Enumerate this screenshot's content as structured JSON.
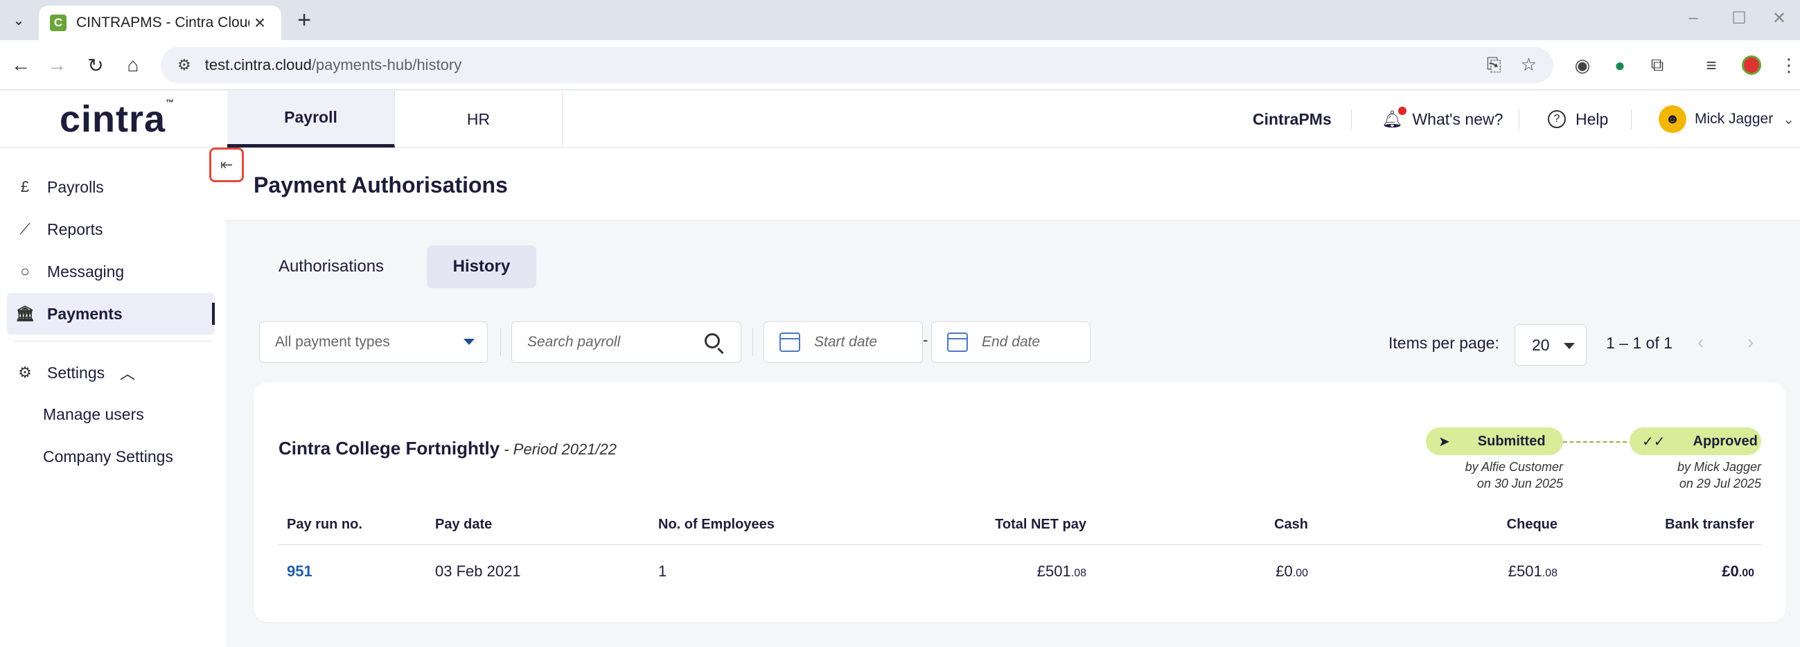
{
  "browser": {
    "tab_title": "CINTRAPMS - Cintra Cloud",
    "favicon_letter": "C",
    "url_host": "test.cintra.cloud",
    "url_path": "/payments-hub/history"
  },
  "header": {
    "logo": "cintra",
    "logo_tm": "™",
    "tabs": [
      {
        "label": "Payroll",
        "active": true
      },
      {
        "label": "HR",
        "active": false
      }
    ],
    "product": "CintraPMs",
    "whats_new": "What's new?",
    "help": "Help",
    "user": "Mick Jagger"
  },
  "sidebar": {
    "items": [
      {
        "label": "Payrolls",
        "icon": "pound-coin-icon"
      },
      {
        "label": "Reports",
        "icon": "chart-line-icon"
      },
      {
        "label": "Messaging",
        "icon": "chat-bubble-icon"
      },
      {
        "label": "Payments",
        "icon": "bank-icon",
        "active": true
      }
    ],
    "settings": {
      "label": "Settings",
      "expanded": true,
      "children": [
        "Manage users",
        "Company Settings"
      ]
    }
  },
  "page": {
    "title": "Payment Authorisations",
    "tabs": [
      {
        "label": "Authorisations",
        "active": false
      },
      {
        "label": "History",
        "active": true
      }
    ]
  },
  "filters": {
    "payment_type": "All payment types",
    "search_placeholder": "Search payroll",
    "start_date_placeholder": "Start date",
    "date_separator": "-",
    "end_date_placeholder": "End date"
  },
  "pagination": {
    "items_per_page_label": "Items per page:",
    "items_per_page": "20",
    "range": "1 – 1 of 1",
    "prev": "‹",
    "next": "›"
  },
  "card": {
    "payroll_name": "Cintra College Fortnightly",
    "period": " - Period 2021/22",
    "steps": [
      {
        "label": "Submitted",
        "by": "by Alfie Customer",
        "on": "on 30 Jun 2025"
      },
      {
        "label": "Approved",
        "by": "by Mick Jagger",
        "on": "on 29 Jul 2025"
      }
    ],
    "columns": [
      "Pay run no.",
      "Pay date",
      "No. of Employees",
      "Total NET pay",
      "Cash",
      "Cheque",
      "Bank transfer"
    ],
    "rows": [
      {
        "pay_run": "951",
        "pay_date": "03 Feb 2021",
        "employees": "1",
        "total_net": {
          "main": "£501",
          "pence": ".08"
        },
        "cash": {
          "main": "£0",
          "pence": ".00"
        },
        "cheque": {
          "main": "£501",
          "pence": ".08"
        },
        "bank_transfer": {
          "main": "£0",
          "pence": ".00"
        }
      }
    ]
  }
}
